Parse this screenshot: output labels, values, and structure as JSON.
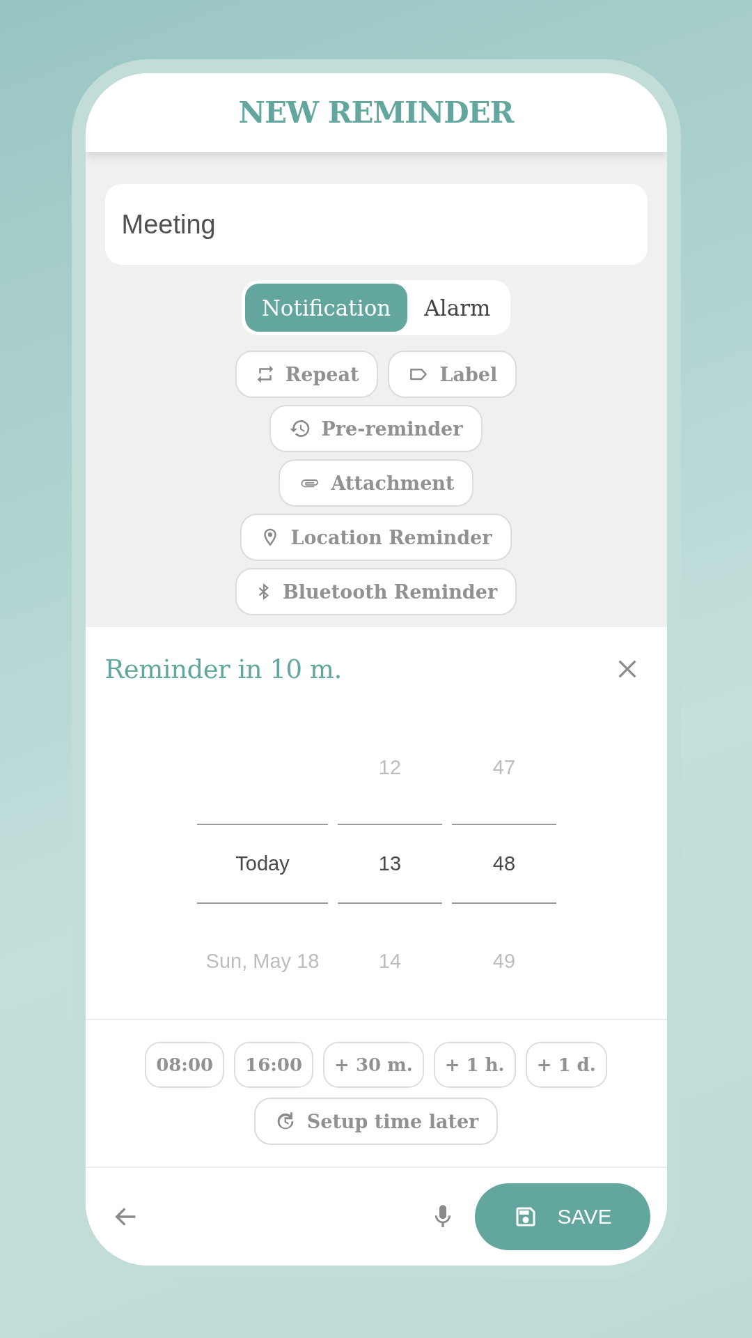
{
  "header": {
    "title": "NEW REMINDER"
  },
  "title_field": {
    "value": "Meeting"
  },
  "mode_toggle": [
    {
      "label": "Notification",
      "selected": true
    },
    {
      "label": "Alarm",
      "selected": false
    }
  ],
  "option_rows": [
    [
      {
        "label": "Repeat",
        "kind": "repeat"
      },
      {
        "label": "Label",
        "kind": "label"
      }
    ],
    [
      {
        "label": "Pre-reminder",
        "kind": "history"
      }
    ],
    [
      {
        "label": "Attachment",
        "kind": "attachment"
      }
    ],
    [
      {
        "label": "Location Reminder",
        "kind": "location"
      }
    ],
    [
      {
        "label": "Bluetooth Reminder",
        "kind": "bluetooth"
      }
    ]
  ],
  "sheet": {
    "title": "Reminder in 10 m.",
    "picker": [
      {
        "current": "Today",
        "below": "Sun, May 18"
      },
      {
        "above": "12",
        "current": "13",
        "below": "14"
      },
      {
        "above": "47",
        "current": "48",
        "below": "49"
      }
    ],
    "quick_times": [
      {
        "label": "08:00"
      },
      {
        "label": "16:00"
      },
      {
        "label": "+ 30 m."
      },
      {
        "label": "+ 1 h."
      },
      {
        "label": "+ 1 d."
      }
    ],
    "later": {
      "label": "Setup time later"
    }
  },
  "bottom_bar": {
    "save_label": "SAVE"
  }
}
